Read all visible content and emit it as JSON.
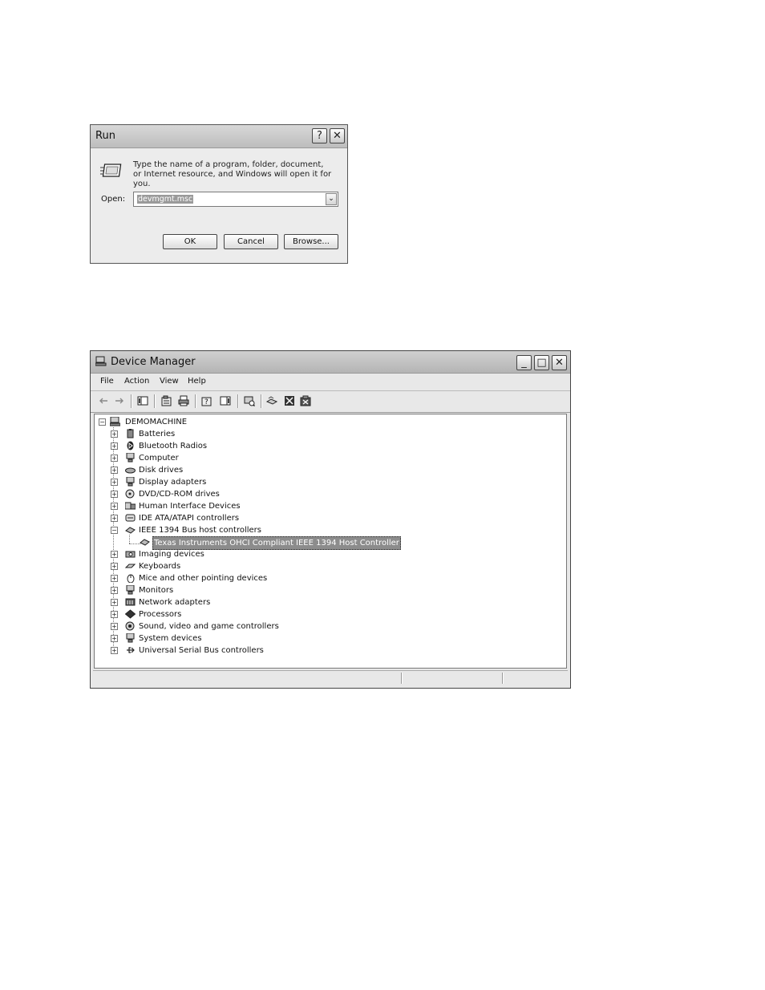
{
  "run_dialog": {
    "title": "Run",
    "help_label": "?",
    "close_label": "✕",
    "description": "Type the name of a program, folder, document, or Internet resource, and Windows will open it for you.",
    "open_label": "Open:",
    "open_value": "devmgmt.msc",
    "dropdown_glyph": "⌄",
    "buttons": {
      "ok": "OK",
      "cancel": "Cancel",
      "browse": "Browse..."
    }
  },
  "device_manager": {
    "title": "Device Manager",
    "window_buttons": {
      "minimize": "_",
      "maximize": "□",
      "close": "✕"
    },
    "menu": [
      "File",
      "Action",
      "View",
      "Help"
    ],
    "root": "DEMOMACHINE",
    "categories": [
      {
        "label": "Batteries",
        "icon": "battery-icon"
      },
      {
        "label": "Bluetooth Radios",
        "icon": "bluetooth-icon"
      },
      {
        "label": "Computer",
        "icon": "computer-icon"
      },
      {
        "label": "Disk drives",
        "icon": "disk-drive-icon"
      },
      {
        "label": "Display adapters",
        "icon": "display-adapter-icon"
      },
      {
        "label": "DVD/CD-ROM drives",
        "icon": "dvd-drive-icon"
      },
      {
        "label": "Human Interface Devices",
        "icon": "hid-icon"
      },
      {
        "label": "IDE ATA/ATAPI controllers",
        "icon": "ide-controller-icon"
      },
      {
        "label": "IEEE 1394 Bus host controllers",
        "icon": "ieee1394-icon"
      },
      {
        "label": "Texas Instruments OHCI Compliant IEEE 1394 Host Controller",
        "icon": "ieee1394-device-icon"
      },
      {
        "label": "Imaging devices",
        "icon": "camera-icon"
      },
      {
        "label": "Keyboards",
        "icon": "keyboard-icon"
      },
      {
        "label": "Mice and other pointing devices",
        "icon": "mouse-icon"
      },
      {
        "label": "Monitors",
        "icon": "monitor-icon"
      },
      {
        "label": "Network adapters",
        "icon": "network-adapter-icon"
      },
      {
        "label": "Processors",
        "icon": "processor-icon"
      },
      {
        "label": "Sound, video and game controllers",
        "icon": "sound-icon"
      },
      {
        "label": "System devices",
        "icon": "system-devices-icon"
      },
      {
        "label": "Universal Serial Bus controllers",
        "icon": "usb-icon"
      }
    ]
  }
}
